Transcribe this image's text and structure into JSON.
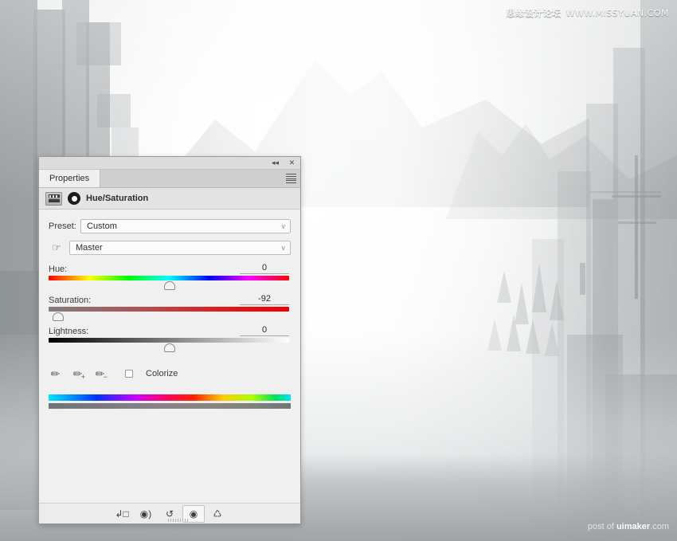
{
  "watermarks": {
    "top_cn": "思缘设计论坛",
    "top_url": "WWW.MISSYUAN.COM",
    "bottom_prefix": "post of ",
    "bottom_brand": "uimaker",
    "bottom_suffix": ".com"
  },
  "panel": {
    "collapse_icon": "◂◂",
    "close_icon": "✕",
    "tab_label": "Properties",
    "menu_icon": "hamburger-menu-icon",
    "adjustment_title": "Hue/Saturation",
    "adjustment_icon": "hue-saturation-adjustment-icon",
    "mask_icon": "layer-mask-icon"
  },
  "preset": {
    "label": "Preset:",
    "value": "Custom",
    "caret": "∨"
  },
  "channel": {
    "hand_icon": "on-image-adjustment-hand-icon",
    "value": "Master",
    "caret": "∨"
  },
  "sliders": [
    {
      "name": "Hue:",
      "value": "0",
      "percent": 50.0,
      "bar": "bar-hue"
    },
    {
      "name": "Saturation:",
      "value": "-92",
      "percent": 4.0,
      "bar": "bar-sat"
    },
    {
      "name": "Lightness:",
      "value": "0",
      "percent": 50.0,
      "bar": "bar-lgt"
    }
  ],
  "eyedroppers": [
    {
      "name": "eyedropper-icon",
      "glyph": "✒",
      "mod": ""
    },
    {
      "name": "eyedropper-add-icon",
      "glyph": "✒",
      "mod": "+"
    },
    {
      "name": "eyedropper-sub-icon",
      "glyph": "✒",
      "mod": "−"
    }
  ],
  "colorize": {
    "label": "Colorize",
    "checked": false
  },
  "footer_buttons": [
    {
      "name": "clip-to-layer-button",
      "glyph": "↳□",
      "active": false
    },
    {
      "name": "view-previous-state-button",
      "glyph": "◉)",
      "active": false
    },
    {
      "name": "reset-button",
      "glyph": "↺",
      "active": false
    },
    {
      "name": "toggle-visibility-button",
      "glyph": "◉",
      "active": true
    },
    {
      "name": "delete-button",
      "glyph": "Ὕ1",
      "active": false
    }
  ]
}
